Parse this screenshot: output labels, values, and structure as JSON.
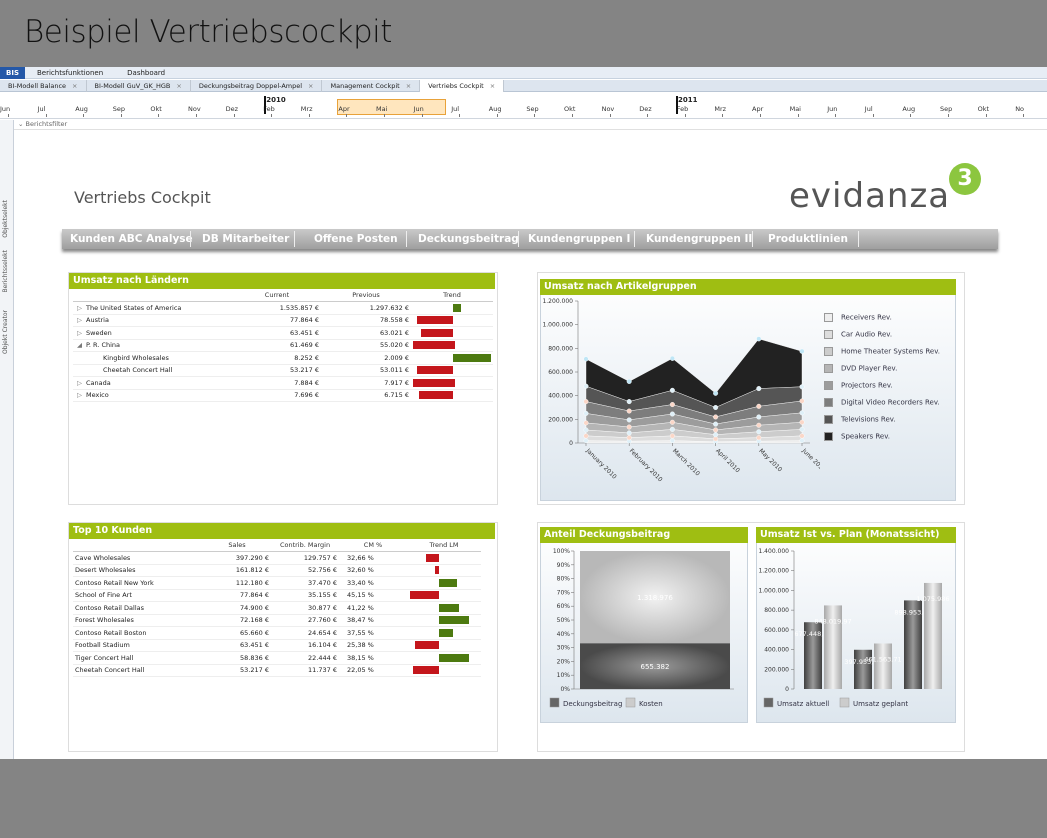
{
  "slide_title": "Beispiel Vertriebscockpit",
  "menubar": {
    "bis": "BIS",
    "items": [
      "Berichtsfunktionen",
      "Dashboard"
    ]
  },
  "tabs": [
    {
      "label": "BI-Modell Balance"
    },
    {
      "label": "BI-Modell GuV_GK_HGB"
    },
    {
      "label": "Deckungsbeitrag Doppel-Ampel"
    },
    {
      "label": "Management Cockpit"
    },
    {
      "label": "Vertriebs Cockpit"
    }
  ],
  "timeline": {
    "years": [
      "2010",
      "2011"
    ],
    "months": [
      "Jun",
      "Jul",
      "Aug",
      "Sep",
      "Okt",
      "Nov",
      "Dez",
      "Feb",
      "Mrz",
      "Apr",
      "Mai",
      "Jun",
      "Jul",
      "Aug",
      "Sep",
      "Okt",
      "Nov",
      "Dez",
      "Feb",
      "Mrz",
      "Apr",
      "Mai",
      "Jun",
      "Jul",
      "Aug",
      "Sep",
      "Okt",
      "No"
    ]
  },
  "filter_label": "Berichtsfilter",
  "left_strip": [
    "Objekt Creator",
    "Berichtsselekt",
    "Objektselekt"
  ],
  "cockpit_title": "Vertriebs Cockpit",
  "logo": {
    "text": "evidanza",
    "sup": "3"
  },
  "nav": [
    "Kunden ABC Analyse",
    "DB Mitarbeiter",
    "Offene Posten",
    "Deckungsbeitrag",
    "Kundengruppen I",
    "Kundengruppen II",
    "Produktlinien"
  ],
  "umsatz_laender": {
    "title": "Umsatz nach Ländern",
    "headers": [
      "",
      "Current",
      "Previous",
      "Trend"
    ],
    "rows": [
      {
        "arrow": "▷",
        "name": "The United States of America",
        "current": "1.535.857 €",
        "previous": "1.297.632 €",
        "trend": 0.1,
        "color": "green",
        "indent": 0
      },
      {
        "arrow": "▷",
        "name": "Austria",
        "current": "77.864 €",
        "previous": "78.558 €",
        "trend": 0.45,
        "color": "red",
        "indent": 0
      },
      {
        "arrow": "▷",
        "name": "Sweden",
        "current": "63.451 €",
        "previous": "63.021 €",
        "trend": 0.4,
        "color": "red",
        "indent": 0
      },
      {
        "arrow": "◢",
        "name": "P. R. China",
        "current": "61.469 €",
        "previous": "55.020 €",
        "trend": 0.52,
        "color": "red",
        "indent": 0
      },
      {
        "arrow": "",
        "name": "Kingbird Wholesales",
        "current": "8.252 €",
        "previous": "2.009 €",
        "trend": 0.48,
        "color": "green",
        "indent": 1
      },
      {
        "arrow": "",
        "name": "Cheetah Concert Hall",
        "current": "53.217 €",
        "previous": "53.011 €",
        "trend": 0.45,
        "color": "red",
        "indent": 1
      },
      {
        "arrow": "▷",
        "name": "Canada",
        "current": "7.884 €",
        "previous": "7.917 €",
        "trend": 0.52,
        "color": "red",
        "indent": 0
      },
      {
        "arrow": "▷",
        "name": "Mexico",
        "current": "7.696 €",
        "previous": "6.715 €",
        "trend": 0.42,
        "color": "red",
        "indent": 0
      }
    ]
  },
  "top10": {
    "title": "Top 10 Kunden",
    "headers": [
      "",
      "Sales",
      "Contrib. Margin",
      "CM %",
      "Trend LM"
    ],
    "rows": [
      {
        "name": "Cave Wholesales",
        "sales": "397.290 €",
        "cm": "129.757 €",
        "pct": "32,66 %",
        "trend": 0.28,
        "color": "red"
      },
      {
        "name": "Desert Wholesales",
        "sales": "161.812 €",
        "cm": "52.756 €",
        "pct": "32,60 %",
        "trend": 0.08,
        "color": "red"
      },
      {
        "name": "Contoso Retail New York",
        "sales": "112.180 €",
        "cm": "37.470 €",
        "pct": "33,40 %",
        "trend": 0.38,
        "color": "green"
      },
      {
        "name": "School of Fine Art",
        "sales": "77.864 €",
        "cm": "35.155 €",
        "pct": "45,15 %",
        "trend": 0.6,
        "color": "red"
      },
      {
        "name": "Contoso Retail Dallas",
        "sales": "74.900 €",
        "cm": "30.877 €",
        "pct": "41,22 %",
        "trend": 0.42,
        "color": "green"
      },
      {
        "name": "Forest Wholesales",
        "sales": "72.168 €",
        "cm": "27.760 €",
        "pct": "38,47 %",
        "trend": 0.62,
        "color": "green"
      },
      {
        "name": "Contoso Retail Boston",
        "sales": "65.660 €",
        "cm": "24.654 €",
        "pct": "37,55 %",
        "trend": 0.3,
        "color": "green"
      },
      {
        "name": "Football Stadium",
        "sales": "63.451 €",
        "cm": "16.104 €",
        "pct": "25,38 %",
        "trend": 0.5,
        "color": "red"
      },
      {
        "name": "Tiger Concert Hall",
        "sales": "58.836 €",
        "cm": "22.444 €",
        "pct": "38,15 %",
        "trend": 0.62,
        "color": "green"
      },
      {
        "name": "Cheetah Concert Hall",
        "sales": "53.217 €",
        "cm": "11.737 €",
        "pct": "22,05 %",
        "trend": 0.55,
        "color": "red"
      }
    ]
  },
  "chart_data": [
    {
      "type": "area",
      "title": "Umsatz nach Artikelgruppen",
      "x": [
        "January 2010",
        "February 2010",
        "March 2010",
        "April 2010",
        "May 2010",
        "June 2010"
      ],
      "ylim": [
        0,
        1200000
      ],
      "yticks": [
        "1.200.000",
        "1.000.000",
        "800.000",
        "600.000",
        "400.000",
        "200.000",
        "0"
      ],
      "series": [
        {
          "name": "Receivers Rev.",
          "values": [
            20000,
            15000,
            20000,
            10000,
            15000,
            20000
          ],
          "color": "#eeeeee"
        },
        {
          "name": "Car Audio Rev.",
          "values": [
            40000,
            30000,
            40000,
            25000,
            30000,
            40000
          ],
          "color": "#dddddd"
        },
        {
          "name": "Home Theater Systems Rev.",
          "values": [
            50000,
            40000,
            55000,
            35000,
            50000,
            55000
          ],
          "color": "#cccccc"
        },
        {
          "name": "DVD Player Rev.",
          "values": [
            60000,
            50000,
            60000,
            40000,
            55000,
            60000
          ],
          "color": "#b5b5b5"
        },
        {
          "name": "Projectors Rev.",
          "values": [
            80000,
            60000,
            70000,
            50000,
            70000,
            80000
          ],
          "color": "#9c9c9c"
        },
        {
          "name": "Digital Video Recorders Rev.",
          "values": [
            100000,
            75000,
            80000,
            60000,
            90000,
            100000
          ],
          "color": "#7d7d7d"
        },
        {
          "name": "Televisions Rev.",
          "values": [
            130000,
            80000,
            120000,
            80000,
            150000,
            120000
          ],
          "color": "#555555"
        },
        {
          "name": "Speakers Rev.",
          "values": [
            230000,
            170000,
            270000,
            120000,
            420000,
            300000
          ],
          "color": "#222222"
        }
      ]
    },
    {
      "type": "bar",
      "title": "Anteil Deckungsbeitrag",
      "categories": [
        ""
      ],
      "yticks": [
        "100%",
        "90%",
        "80%",
        "70%",
        "60%",
        "50%",
        "40%",
        "30%",
        "20%",
        "10%",
        "0%"
      ],
      "series": [
        {
          "name": "Deckungsbeitrag",
          "values": [
            655382
          ],
          "label": "655.382",
          "color": "#666666"
        },
        {
          "name": "Kosten",
          "values": [
            1318976
          ],
          "label": "1.318.976",
          "color": "#cccccc"
        }
      ]
    },
    {
      "type": "bar",
      "title": "Umsatz Ist vs. Plan (Monatssicht)",
      "categories": [
        "",
        "",
        ""
      ],
      "ylim": [
        0,
        1400000
      ],
      "yticks": [
        "1.400.000",
        "1.200.000",
        "1.000.000",
        "800.000",
        "600.000",
        "400.000",
        "200.000",
        "0"
      ],
      "series": [
        {
          "name": "Umsatz aktuell",
          "values": [
            677448.24,
            397953.64,
            898953.45
          ],
          "labels": [
            "677.448,24",
            "397.953,64",
            "898.953,45"
          ],
          "color": "#666666"
        },
        {
          "name": "Umsatz geplant",
          "values": [
            848019.97,
            461563.71,
            1075986
          ],
          "labels": [
            "848.019,97",
            "461.563,71",
            "1.075.986"
          ],
          "color": "#cccccc"
        }
      ]
    }
  ]
}
